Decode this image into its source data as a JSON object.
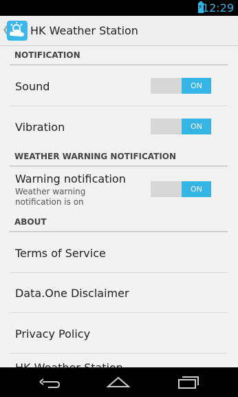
{
  "status_bar": {
    "time": "12:29"
  },
  "action_bar": {
    "title": "HK Weather Station"
  },
  "sections": {
    "notification": "NOTIFICATION",
    "weather_warning": "WEATHER WARNING NOTIFICATION",
    "about": "ABOUT"
  },
  "settings": {
    "sound": {
      "label": "Sound",
      "state": "ON"
    },
    "vibration": {
      "label": "Vibration",
      "state": "ON"
    },
    "warning": {
      "label": "Warning notification",
      "summary": "Weather warning notification is on",
      "state": "ON"
    }
  },
  "about_items": [
    "Terms of Service",
    "Data.One Disclaimer",
    "Privacy Policy",
    "HK Weather Station"
  ],
  "colors": {
    "accent": "#33b5e5",
    "background": "#f2f2f2"
  }
}
